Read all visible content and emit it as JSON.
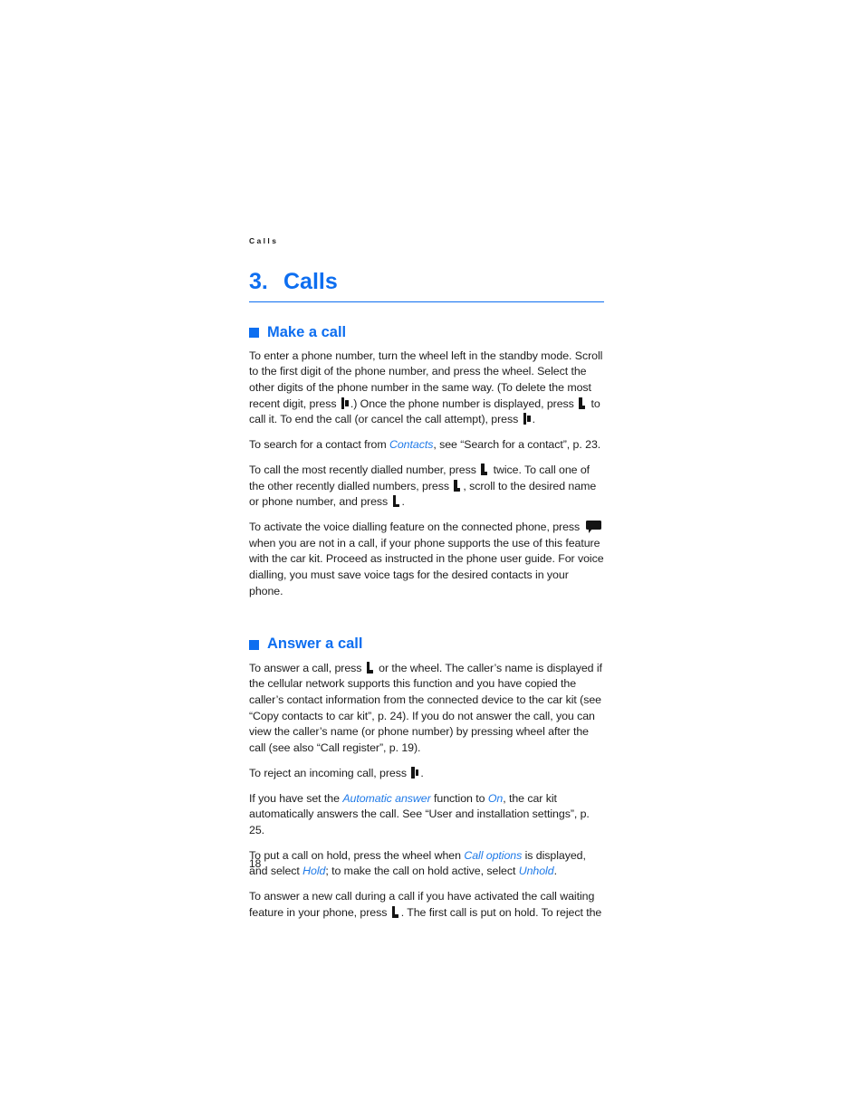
{
  "document": {
    "running_header": "Calls",
    "page_number": "18",
    "accent_color": "#0d6ef0",
    "term_color": "#1f7ae8",
    "text_color": "#1c1c1c"
  },
  "chapter": {
    "number": "3.",
    "title": "Calls"
  },
  "sections": [
    {
      "id": "make-a-call",
      "heading": "Make a call",
      "bullet_icon": "blue-square-bullet",
      "paragraphs": [
        {
          "id": "enter-number",
          "runs": [
            {
              "type": "text",
              "text": "To enter a phone number, turn the wheel left in the standby mode. Scroll to the first digit of the phone number, and press the wheel. Select the other digits of the phone number in the same way. (To delete the most recent digit, press "
            },
            {
              "type": "key",
              "icon": "end-call-key-icon"
            },
            {
              "type": "text",
              "text": ".) Once the phone number is displayed, press "
            },
            {
              "type": "key",
              "icon": "call-key-icon"
            },
            {
              "type": "text",
              "text": " to call it. To end the call (or cancel the call attempt), press "
            },
            {
              "type": "key",
              "icon": "end-call-key-icon"
            },
            {
              "type": "text",
              "text": "."
            }
          ]
        },
        {
          "id": "search-contact",
          "runs": [
            {
              "type": "text",
              "text": "To search for a contact from "
            },
            {
              "type": "term",
              "text": "Contacts"
            },
            {
              "type": "text",
              "text": ", see “Search for a contact”, p. 23."
            }
          ]
        },
        {
          "id": "recently-dialled",
          "runs": [
            {
              "type": "text",
              "text": "To call the most recently dialled number, press "
            },
            {
              "type": "key",
              "icon": "call-key-icon"
            },
            {
              "type": "text",
              "text": " twice. To call one of the other recently dialled numbers, press "
            },
            {
              "type": "key",
              "icon": "call-key-icon"
            },
            {
              "type": "text",
              "text": ", scroll to the desired name or phone number, and press "
            },
            {
              "type": "key",
              "icon": "call-key-icon"
            },
            {
              "type": "text",
              "text": "."
            }
          ]
        },
        {
          "id": "voice-dialling",
          "runs": [
            {
              "type": "text",
              "text": "To activate the voice dialling feature on the connected phone, press "
            },
            {
              "type": "key",
              "icon": "voice-key-icon"
            },
            {
              "type": "text",
              "text": " when you are not in a call, if your phone supports the use of this feature with the car kit. Proceed as instructed in the phone user guide. For voice dialling, you must save voice tags for the desired contacts in your phone."
            }
          ]
        }
      ]
    },
    {
      "id": "answer-a-call",
      "heading": "Answer a call",
      "bullet_icon": "blue-square-bullet",
      "paragraphs": [
        {
          "id": "answer-call",
          "runs": [
            {
              "type": "text",
              "text": "To answer a call, press "
            },
            {
              "type": "key",
              "icon": "call-key-icon"
            },
            {
              "type": "text",
              "text": " or the wheel. The caller’s name is displayed if the cellular network supports this function and you have copied the caller’s contact information from the connected device to the car kit (see “Copy contacts to car kit”, p. 24). If you do not answer the call, you can view the caller’s name (or phone number) by pressing wheel after the call (see also “Call register”, p. 19)."
            }
          ]
        },
        {
          "id": "reject-call",
          "runs": [
            {
              "type": "text",
              "text": "To reject an incoming call, press "
            },
            {
              "type": "key",
              "icon": "end-call-key-icon"
            },
            {
              "type": "text",
              "text": "."
            }
          ]
        },
        {
          "id": "automatic-answer",
          "runs": [
            {
              "type": "text",
              "text": "If you have set the "
            },
            {
              "type": "term",
              "text": "Automatic answer"
            },
            {
              "type": "text",
              "text": " function to "
            },
            {
              "type": "term",
              "text": "On"
            },
            {
              "type": "text",
              "text": ", the car kit automatically answers the call. See “User and installation settings”, p. 25."
            }
          ]
        },
        {
          "id": "hold-call",
          "runs": [
            {
              "type": "text",
              "text": "To put a call on hold, press the wheel when "
            },
            {
              "type": "term",
              "text": "Call options"
            },
            {
              "type": "text",
              "text": " is displayed, and select "
            },
            {
              "type": "term",
              "text": "Hold"
            },
            {
              "type": "text",
              "text": "; to make the call on hold active, select "
            },
            {
              "type": "term",
              "text": "Unhold"
            },
            {
              "type": "text",
              "text": "."
            }
          ]
        },
        {
          "id": "call-waiting",
          "runs": [
            {
              "type": "text",
              "text": "To answer a new call during a call if you have activated the call waiting feature in your phone, press "
            },
            {
              "type": "key",
              "icon": "call-key-icon"
            },
            {
              "type": "text",
              "text": ". The first call is put on hold. To reject the"
            }
          ]
        }
      ]
    }
  ]
}
